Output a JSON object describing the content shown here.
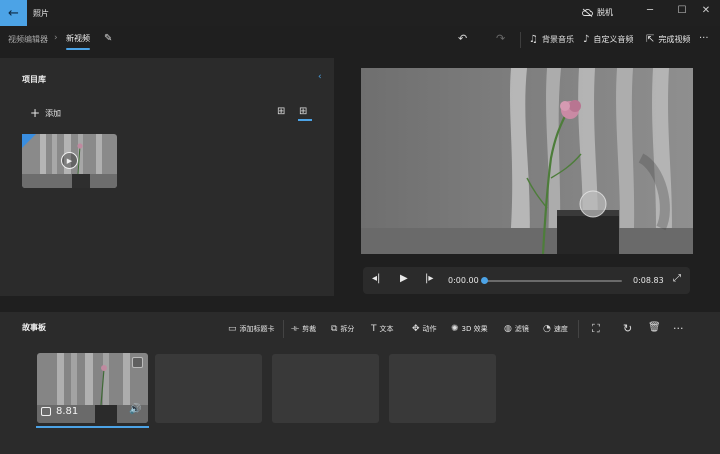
{
  "titlebar": {
    "app_title": "照片",
    "back_icon": "arrow-left-icon",
    "offline_label": "脱机",
    "offline_icon": "cloud-off-icon",
    "minimize": "─",
    "maximize": "☐",
    "close": "✕"
  },
  "toolbar": {
    "breadcrumb_editor": "视频编辑器",
    "breadcrumb_sep": "›",
    "project_name": "新视频",
    "edit_icon": "✎",
    "undo_icon": "↶",
    "redo_icon": "↷",
    "bg_music": "背景音乐",
    "custom_audio": "自定义音频",
    "finish_video": "完成视频",
    "more": "···"
  },
  "library": {
    "title": "项目库",
    "collapse_icon": "‹",
    "add_label": "添加",
    "add_icon": "+",
    "view_small_icon": "⊞",
    "view_large_icon": "⊞"
  },
  "player": {
    "prev_icon": "◂|",
    "play_icon": "▶",
    "next_icon": "|▸",
    "current_time": "0:00.00",
    "total_time": "0:08.83",
    "progress": 0.0,
    "fullscreen_icon": "⤢"
  },
  "storyboard": {
    "title": "故事板",
    "tools": [
      {
        "icon": "▭",
        "label": "添加标题卡"
      },
      {
        "icon": "⟛",
        "label": "剪裁"
      },
      {
        "icon": "⧉",
        "label": "拆分"
      },
      {
        "icon": "T",
        "label": "文本"
      },
      {
        "icon": "✥",
        "label": "动作"
      },
      {
        "icon": "✺",
        "label": "3D 效果"
      },
      {
        "icon": "◍",
        "label": "滤镜"
      },
      {
        "icon": "◔",
        "label": "速度"
      }
    ],
    "resize_icon": "⛶",
    "rotate_icon": "↻",
    "delete_icon": "🗑",
    "more": "···",
    "clip_duration": "8.81",
    "audio_icon": "🔊"
  },
  "colors": {
    "accent": "#4ca3e6",
    "panel": "#2b2b2b",
    "background": "#1f1f1f"
  }
}
